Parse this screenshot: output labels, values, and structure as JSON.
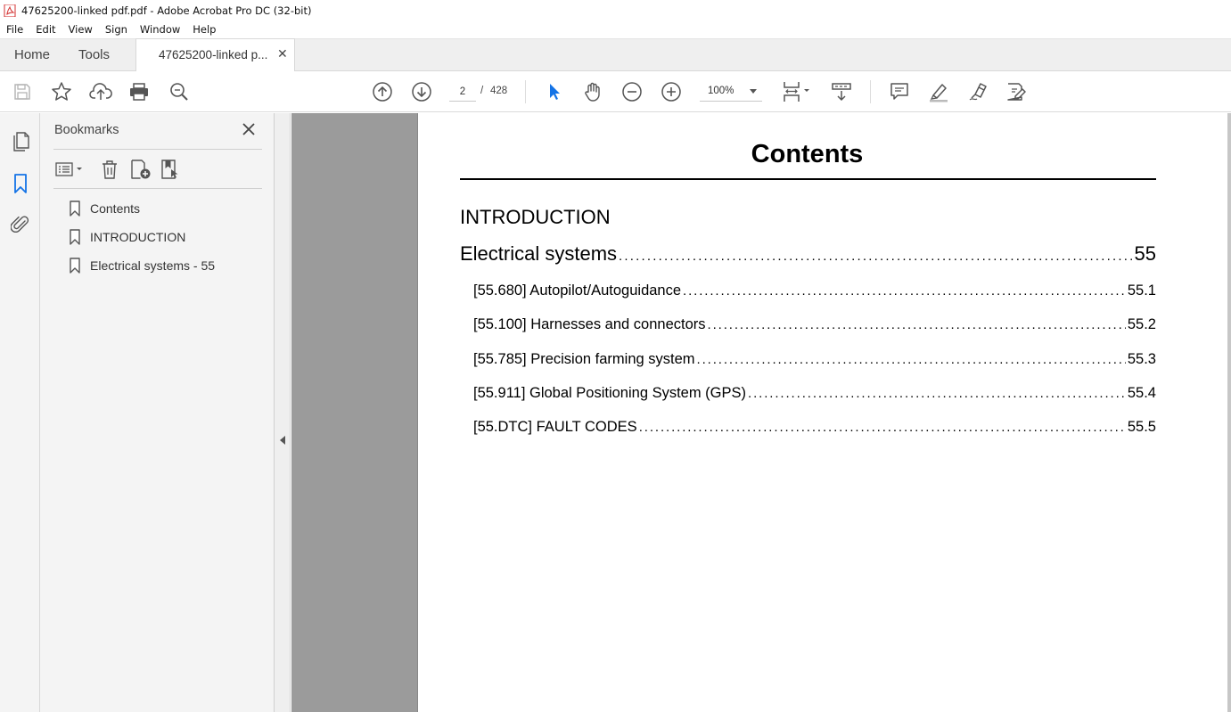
{
  "window": {
    "title": "47625200-linked pdf.pdf - Adobe Acrobat Pro DC (32-bit)"
  },
  "menubar": {
    "items": [
      "File",
      "Edit",
      "View",
      "Sign",
      "Window",
      "Help"
    ]
  },
  "tabs": {
    "home": "Home",
    "tools": "Tools",
    "document": "47625200-linked p..."
  },
  "toolbar": {
    "current_page": "2",
    "page_separator": "/",
    "total_pages": "428",
    "zoom": "100%",
    "accent_color": "#1473e6"
  },
  "bookmarks": {
    "header": "Bookmarks",
    "items": [
      {
        "label": "Contents"
      },
      {
        "label": "INTRODUCTION"
      },
      {
        "label": "Electrical systems - 55"
      }
    ]
  },
  "document": {
    "title": "Contents",
    "intro_heading": "INTRODUCTION",
    "main_entry": {
      "text": "Electrical systems",
      "page": "55"
    },
    "sub_entries": [
      {
        "text": "[55.680] Autopilot/Autoguidance",
        "page": "55.1"
      },
      {
        "text": "[55.100] Harnesses and connectors",
        "page": "55.2"
      },
      {
        "text": "[55.785] Precision farming system",
        "page": "55.3"
      },
      {
        "text": "[55.911] Global Positioning System (GPS)",
        "page": "55.4"
      },
      {
        "text": "[55.DTC] FAULT CODES",
        "page": "55.5"
      }
    ]
  }
}
